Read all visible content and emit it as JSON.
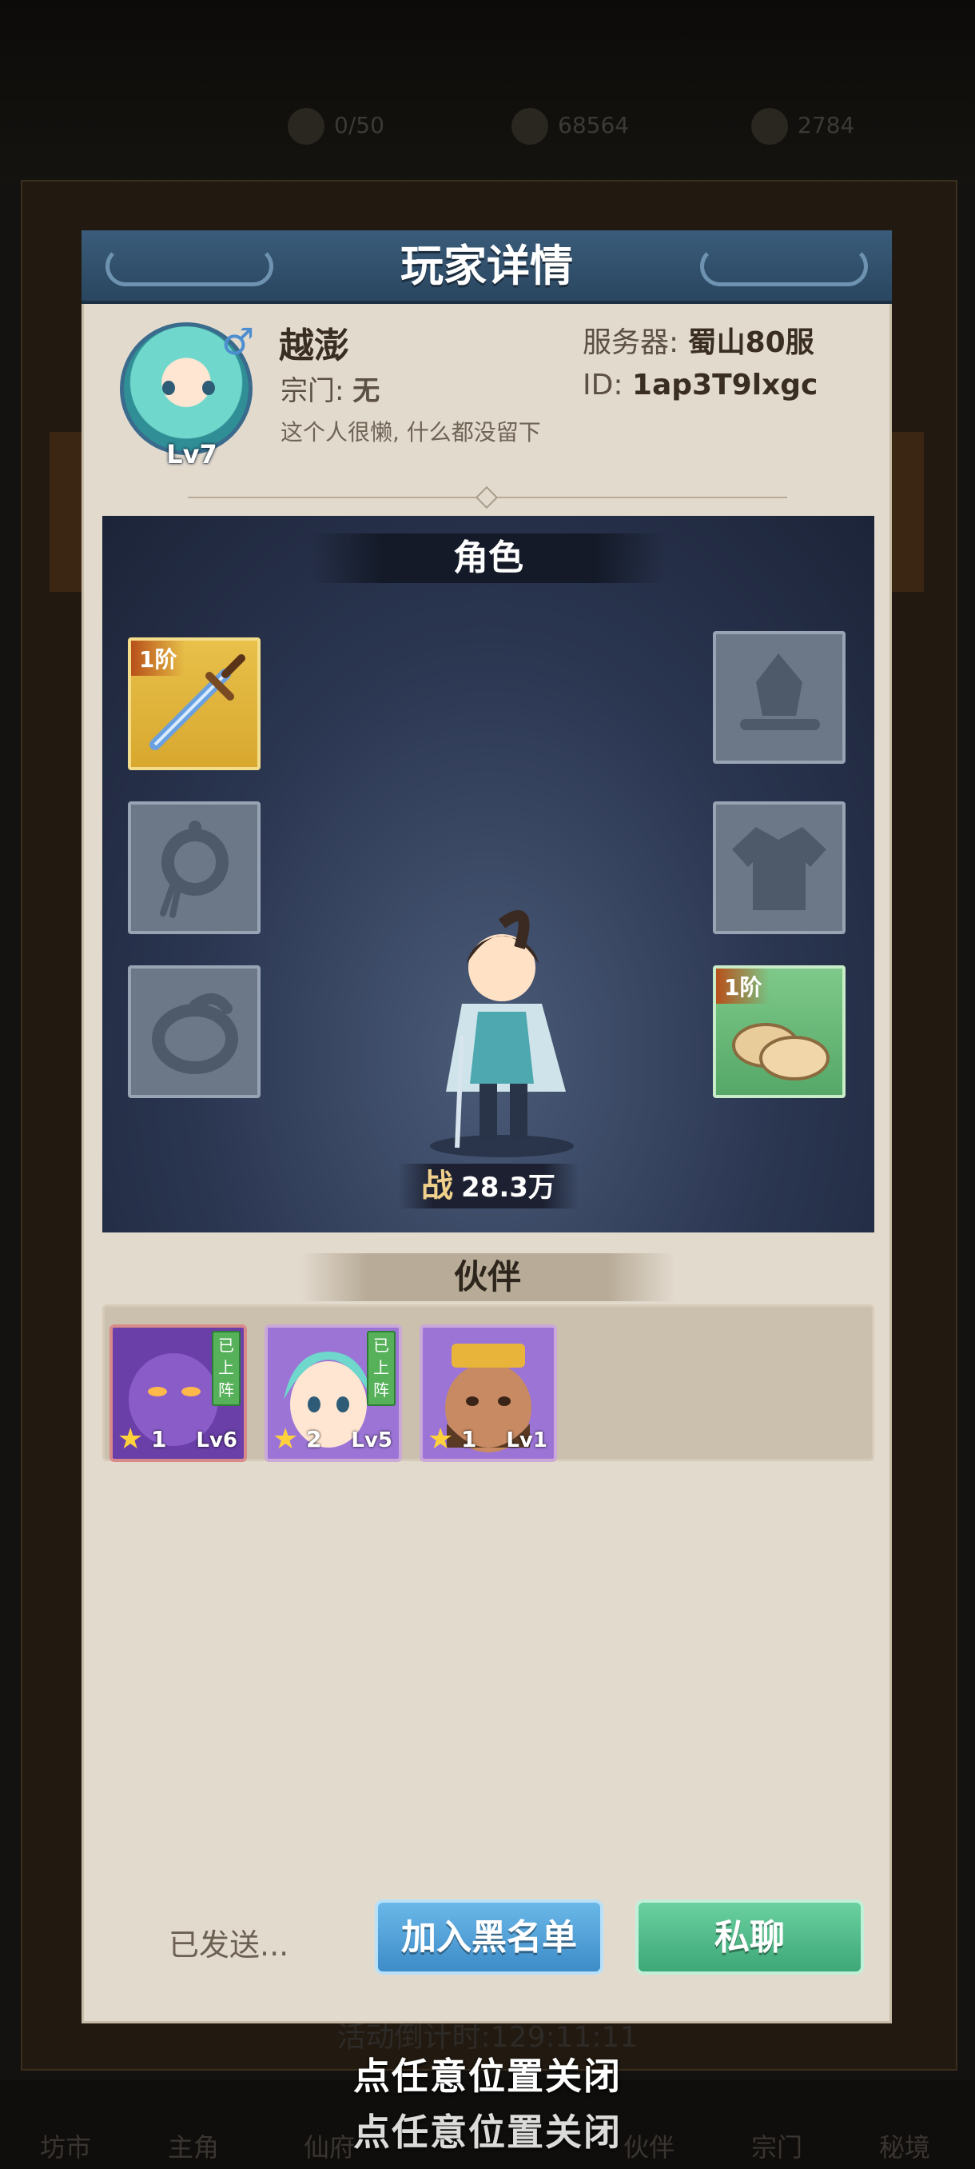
{
  "background": {
    "stats": [
      "0/50",
      "68564",
      "2784"
    ],
    "event_text": "活动倒计时:129:11:11",
    "tabs": [
      "坊市",
      "主角",
      "仙府",
      "伙伴",
      "宗门",
      "秘境"
    ]
  },
  "close_hint": "点任意位置关闭",
  "modal": {
    "title": "玩家详情",
    "profile": {
      "name": "越澎",
      "level": "Lv7",
      "gender_icon": "male-icon",
      "guild_label": "宗门:",
      "guild_value": "无",
      "signature": "这个人很懒, 什么都没留下",
      "server_label": "服务器:",
      "server_value": "蜀山80服",
      "id_label": "ID:",
      "id_value": "1ap3T9lxgc"
    },
    "role": {
      "title": "角色",
      "power_label": "战",
      "power_value": "28.3万",
      "slots": {
        "weapon": {
          "tier": "1阶",
          "icon": "sword-icon"
        },
        "hat": {
          "icon": "hat-icon"
        },
        "necklace": {
          "icon": "necklace-icon"
        },
        "armor": {
          "icon": "robe-icon"
        },
        "ring": {
          "icon": "ring-icon"
        },
        "boots": {
          "tier": "1阶",
          "icon": "shoes-icon"
        }
      }
    },
    "partners": {
      "title": "伙伴",
      "items": [
        {
          "deployed": "已上阵",
          "stars": "1",
          "level": "Lv6",
          "color": "#8a5cc8"
        },
        {
          "deployed": "已上阵",
          "stars": "2",
          "level": "Lv5",
          "color": "#9c74d6"
        },
        {
          "deployed": "",
          "stars": "1",
          "level": "Lv1",
          "color": "#8b6048"
        }
      ]
    },
    "footer": {
      "status": "已发送...",
      "blacklist_label": "加入黑名单",
      "chat_label": "私聊"
    }
  },
  "colors": {
    "modal_bg": "#e3dace",
    "header_blue": "#2a4660",
    "role_bg": "#2a3550",
    "gold_slot": "#e8c04a",
    "green_slot": "#7ec98a",
    "blacklist_button": "#3e8cc8",
    "chat_button": "#3ea878"
  }
}
